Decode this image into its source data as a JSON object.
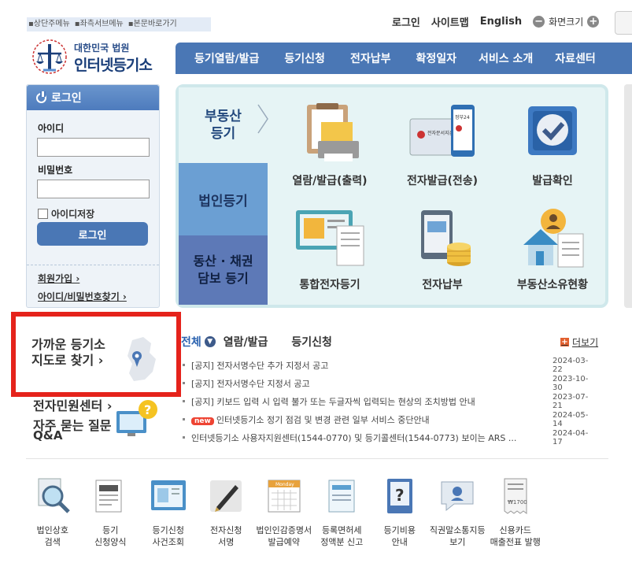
{
  "skip_links": [
    "▪상단주메뉴",
    "▪좌측서브메뉴",
    "▪본문바로가기"
  ],
  "util": {
    "login": "로그인",
    "sitemap": "사이트맵",
    "english": "English",
    "zoom_label": "화면크기",
    "minus": "−",
    "plus": "+"
  },
  "logo": {
    "small": "대한민국 법원",
    "big": "인터넷등기소"
  },
  "nav": [
    "등기열람/발급",
    "등기신청",
    "전자납부",
    "확정일자",
    "서비스 소개",
    "자료센터"
  ],
  "login": {
    "title": "로그인",
    "id_label": "아이디",
    "pw_label": "비밀번호",
    "save_id": "아이디저장",
    "button": "로그인",
    "signup": "회원가입 ›",
    "find": "아이디/비밀번호찾기 ›"
  },
  "categories": {
    "realestate_l1": "부동산",
    "realestate_l2": "등기",
    "corporate": "법인등기",
    "movable_l1": "동산 · 채권",
    "movable_l2": "담보 등기"
  },
  "services": [
    "열람/발급(출력)",
    "전자발급(전송)",
    "발급확인",
    "통합전자등기",
    "전자납부",
    "부동산소유현황"
  ],
  "icon_texts": {
    "gov24": "정부24",
    "egov_doc": "전자문서지갑"
  },
  "nearby": {
    "line1": "가까운 등기소",
    "line2": "지도로 찾기 ›"
  },
  "civil_center": "전자민원센터 ›",
  "faq": {
    "line1": "자주 묻는 질문",
    "line2": "Q&A",
    "mark": "?"
  },
  "notice_tabs": {
    "all": "전체",
    "view": "열람/발급",
    "apply": "등기신청",
    "more": "더보기",
    "more_mark": "+",
    "dropdown": "▼"
  },
  "notices": [
    {
      "title": "[공지] 전자서명수단 추가 지정서 공고",
      "date": "2024-03-22",
      "new": false
    },
    {
      "title": "[공지] 전자서명수단 지정서 공고",
      "date": "2023-10-30",
      "new": false
    },
    {
      "title": "[공지] 키보드 입력 시 입력 불가 또는 두글자씩 입력되는 현상의 조치방법 안내",
      "date": "2023-07-21",
      "new": false
    },
    {
      "title": "인터넷등기소 정기 점검 및 변경 관련 일부 서비스 중단안내",
      "date": "2024-05-14",
      "new": true,
      "badge": "new"
    },
    {
      "title": "인터넷등기소 사용자지원센터(1544-0770) 및 등기콜센터(1544-0773) 보이는 ARS ...",
      "date": "2024-04-17",
      "new": false
    }
  ],
  "quick_links": [
    "법인상호\n검색",
    "등기\n신청양식",
    "등기신청\n사건조회",
    "전자신청\n서명",
    "법인인감증명서\n발급예약",
    "등록면허세\n정액분 신고",
    "등기비용\n안내",
    "직권말소통지등\n보기",
    "신용카드\n매출전표 발행"
  ],
  "quick_icon_texts": {
    "calendar": "Monday",
    "receipt": "₩1700"
  },
  "colors": {
    "nav_blue": "#4a77b5",
    "highlight_red": "#e5231b",
    "panel_teal": "#e6f4f5",
    "new_badge": "#ee4433"
  }
}
